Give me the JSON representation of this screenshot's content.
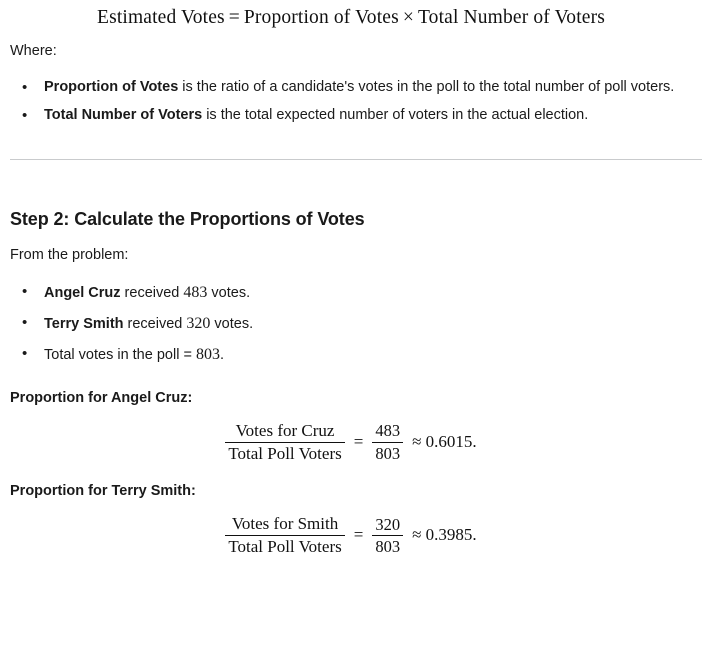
{
  "top_formula": {
    "lhs": "Estimated Votes",
    "equals": "=",
    "rhs_first": "Proportion of Votes",
    "times": "×",
    "rhs_second": "Total Number of Voters"
  },
  "where_intro": "Where:",
  "where_bullets": [
    {
      "term": "Proportion of Votes",
      "rest": " is the ratio of a candidate's votes in the poll to the total number of poll voters."
    },
    {
      "term": "Total Number of Voters",
      "rest": " is the total expected number of voters in the actual election."
    }
  ],
  "step2": {
    "heading": "Step 2: Calculate the Proportions of Votes",
    "intro": "From the problem:",
    "bullets": [
      {
        "term": "Angel Cruz",
        "mid": " received ",
        "value": "483",
        "tail": " votes."
      },
      {
        "term": "Terry Smith",
        "mid": " received ",
        "value": "320",
        "tail": " votes."
      },
      {
        "term": "",
        "mid": "Total votes in the poll = ",
        "value": "803",
        "tail": "."
      }
    ]
  },
  "cruz": {
    "label": "Proportion for Angel Cruz:",
    "numerator": "Votes for Cruz",
    "denominator": "Total Poll Voters",
    "equals": "=",
    "frac_numerator": "483",
    "frac_denominator": "803",
    "approx": "≈ 0.6015."
  },
  "smith": {
    "label": "Proportion for Terry Smith:",
    "numerator": "Votes for Smith",
    "denominator": "Total Poll Voters",
    "equals": "=",
    "frac_numerator": "320",
    "frac_denominator": "803",
    "approx": "≈ 0.3985."
  },
  "colors": {
    "text": "#1a1a1a",
    "math": "#111111",
    "divider": "#c9cbcd",
    "background": "#ffffff"
  }
}
